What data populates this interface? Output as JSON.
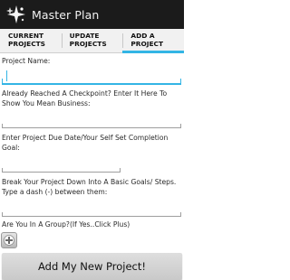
{
  "app": {
    "title": "Master Plan"
  },
  "tabs": [
    {
      "label": "Current Projects"
    },
    {
      "label": "Update Projects"
    },
    {
      "label": "Add A Project",
      "active": true
    }
  ],
  "form": {
    "project_name_label": "Project Name:",
    "checkpoint_label": "Already Reached A Checkpoint? Enter It Here To Show You Mean Business:",
    "due_date_label": "Enter Project Due Date/Your Self Set Completion Goal:",
    "steps_label": "Break Your Project Down Into A Basic Goals/ Steps. Type a dash (-) between them:",
    "group_label": "Are You In A Group?(If Yes..Click Plus)",
    "submit_label": "Add My New Project!"
  },
  "colors": {
    "accent": "#33b5e5",
    "actionbar": "#1b1b1b"
  },
  "icons": {
    "app": "sparkle-app-icon",
    "add_member": "add-member-icon"
  }
}
